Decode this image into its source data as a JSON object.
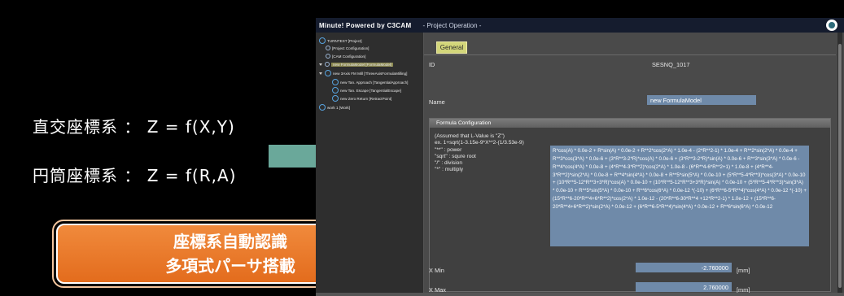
{
  "slide": {
    "formula_cartesian": "直交座標系 ： Z = f(X,Y)",
    "formula_cylindrical": "円筒座標系 ： Z = f(R,A)",
    "badge_line1": "座標系自動認識",
    "badge_line2": "多項式パーサ搭載",
    "arrow_color": "#6aa89a",
    "badge_color": "#e8782a"
  },
  "app": {
    "title": "Minute! Powered by C3CAM",
    "subtitle": "- Project Operation -",
    "tree": {
      "root": "TURNTEST [Project]",
      "project_config": "[Project Configuration]",
      "cam_config": "[CAM Configuration]",
      "selected_item": "new FormulaModel [FormulaModel]",
      "mill": "new 3Axis FM Mill [ThreeAxisFormulaMilling]",
      "approach": "new Tan. Approach [TangentialApproach]",
      "escape": "new Tan. Escape [TangentialEscape]",
      "zero_return": "new Zero Return [RetractPoint]",
      "work": "work 1 [Work]"
    },
    "panel": {
      "tab_general": "General",
      "id_label": "ID",
      "id_value": "SESNQ_1017",
      "name_label": "Name",
      "name_value": "new FormulaModel",
      "group_title": "Formula Configuration",
      "help_text": "(Assumed that L-Value is \"Z\")\nex. 1+sqrt(1-3.15e-9*X**2-(1/3.53e-9)\n\"**\" : power\n\"sqrt\" : squre root\n\"/\" : division\n\"*\" : multiply",
      "formula": "R*cos(A) * 0.0e-2 + R*sin(A) * 0.0e-2 + R**2*cos(2*A) * 1.0e-4 - (2*R**2-1) * 1.0e-4 + R**2*sin(2*A) * 0.0e-4 + R**3*cos(3*A) * 0.0e-6 + (3*R**3-2*R)*cos(A) * 0.0e-6 + (3*R**3-2*R)*sin(A) * 0.0e-6 + R**3*sin(3*A) * 0.0e-6 - R**4*cos(4*A) * 0.0e-8 + (4*R**4-3*R**2)*cos(2*A) * 1.0e-8 - (6*R**4-6*R**2+1) * 1.0e-8 + (4*R**4-3*R**2)*sin(2*A) * 0.0e-8 + R**4*sin(4*A) * 0.0e-8 + R**5*sin(5*A) * 0.0e-10 + (5*R**5-4*R**3)*cos(3*A) * 0.0e-10 + (10*R**5-12*R**3+3*R)*cos(A) * 0.0e-10 + (10*R**5-12*R**3+3*R)*sin(A) * 0.0e-10 + (5*R**5-4*R**3)*sin(3*A) * 0.0e-10 + R**5*sin(5*A) * 0.0e-10 + R**6*cos(6*A) * 0.0e-12 *(-10) + (6*R**6-5*R**4)*cos(4*A) * 0.0e-12 *(-10) + (15*R**6-20*R**4+6*R**2)*cos(2*A) * 1.0e-12 - (20*R**6-30*R**4 +12*R**2-1) * 1.0e-12 + (15*R**6-20*R**4+6*R**2)*sin(2*A) * 0.0e-12 + (6*R**6-5*R**4)*sin(4*A) * 0.0e-12 + R**6*sin(6*A) * 0.0e-12",
      "xmin_label": "X Min",
      "xmin_value": "-2.760000",
      "xmax_label": "X Max",
      "xmax_value": "2.760000",
      "unit": "[mm]"
    }
  }
}
